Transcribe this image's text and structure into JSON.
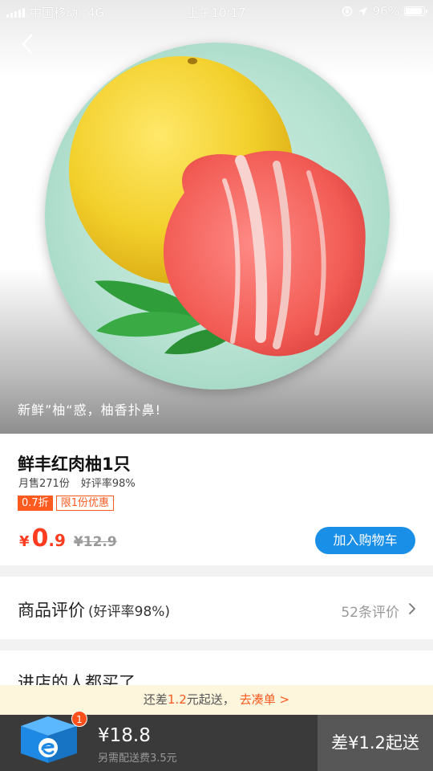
{
  "status_bar": {
    "carrier": "中国移动",
    "network": "4G",
    "time": "上午10:17",
    "battery": "96%"
  },
  "hero": {
    "tagline": "新鲜”柚“惑，柚香扑鼻!"
  },
  "product": {
    "title": "鲜丰红肉柚1只",
    "monthly_sales": "月售271份",
    "rating": "好评率98%",
    "discount_badge": "0.7折",
    "limit_badge": "限1份优惠",
    "price_symbol": "¥",
    "price_int": "0",
    "price_dec": ".9",
    "original_price": "¥12.9",
    "add_to_cart": "加入购物车"
  },
  "reviews": {
    "title": "商品评价",
    "rate": "(好评率98%)",
    "count": "52条评价"
  },
  "recommend": {
    "title": "进店的人都买了"
  },
  "min_order": {
    "prefix": "还差",
    "amount": "1.2",
    "suffix": "元起送，",
    "link": "去凑单 >"
  },
  "cart": {
    "badge": "1",
    "total": "¥18.8",
    "delivery": "另需配送费3.5元",
    "checkout": "差¥1.2起送"
  },
  "colors": {
    "accent_orange": "#ff5a1f",
    "price_red": "#ff3c1f",
    "button_blue": "#1a8fe8",
    "cart_bar": "#3a3a3a"
  }
}
